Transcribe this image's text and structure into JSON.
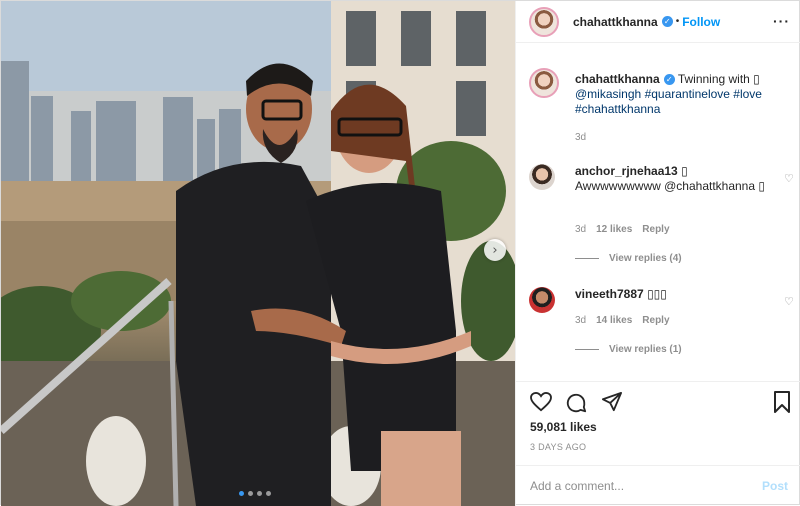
{
  "post": {
    "author": "chahattkhanna",
    "follow_label": "Follow",
    "separator": "•",
    "more_label": "···",
    "verified_mark": "✓",
    "icons": {
      "verified": "verified-badge-icon",
      "more": "more-options-icon",
      "next": "chevron-right-icon",
      "like": "heart-icon",
      "comment": "comment-icon",
      "share": "paper-plane-icon",
      "save": "bookmark-icon"
    }
  },
  "caption": {
    "author": "chahattkhanna",
    "text": "Twinning with ▯",
    "mention": "@mikasingh",
    "hashtags": "#quarantinelove #love #chahattkhanna",
    "time": "3d"
  },
  "comments": [
    {
      "author": "anchor_rjnehaa13",
      "author_suffix": "▯",
      "text": "Awwwwwwwww @chahattkhanna ▯",
      "time": "3d",
      "likes": "12 likes",
      "reply_label": "Reply",
      "view_replies": "View replies (4)"
    },
    {
      "author": "vineeth7887",
      "author_suffix": "▯▯▯",
      "text": "",
      "time": "3d",
      "likes": "14 likes",
      "reply_label": "Reply",
      "view_replies": "View replies (1)"
    }
  ],
  "stats": {
    "likes": "59,081 likes",
    "posted": "3 DAYS AGO"
  },
  "composer": {
    "placeholder": "Add a comment...",
    "post_label": "Post"
  },
  "carousel": {
    "slide_count": 4,
    "active_index": 0
  },
  "colors": {
    "link": "#00376b",
    "follow": "#0095f6",
    "verified": "#3897f0",
    "post_disabled": "#b2dffc",
    "secondary_text": "#8e8e8e"
  }
}
